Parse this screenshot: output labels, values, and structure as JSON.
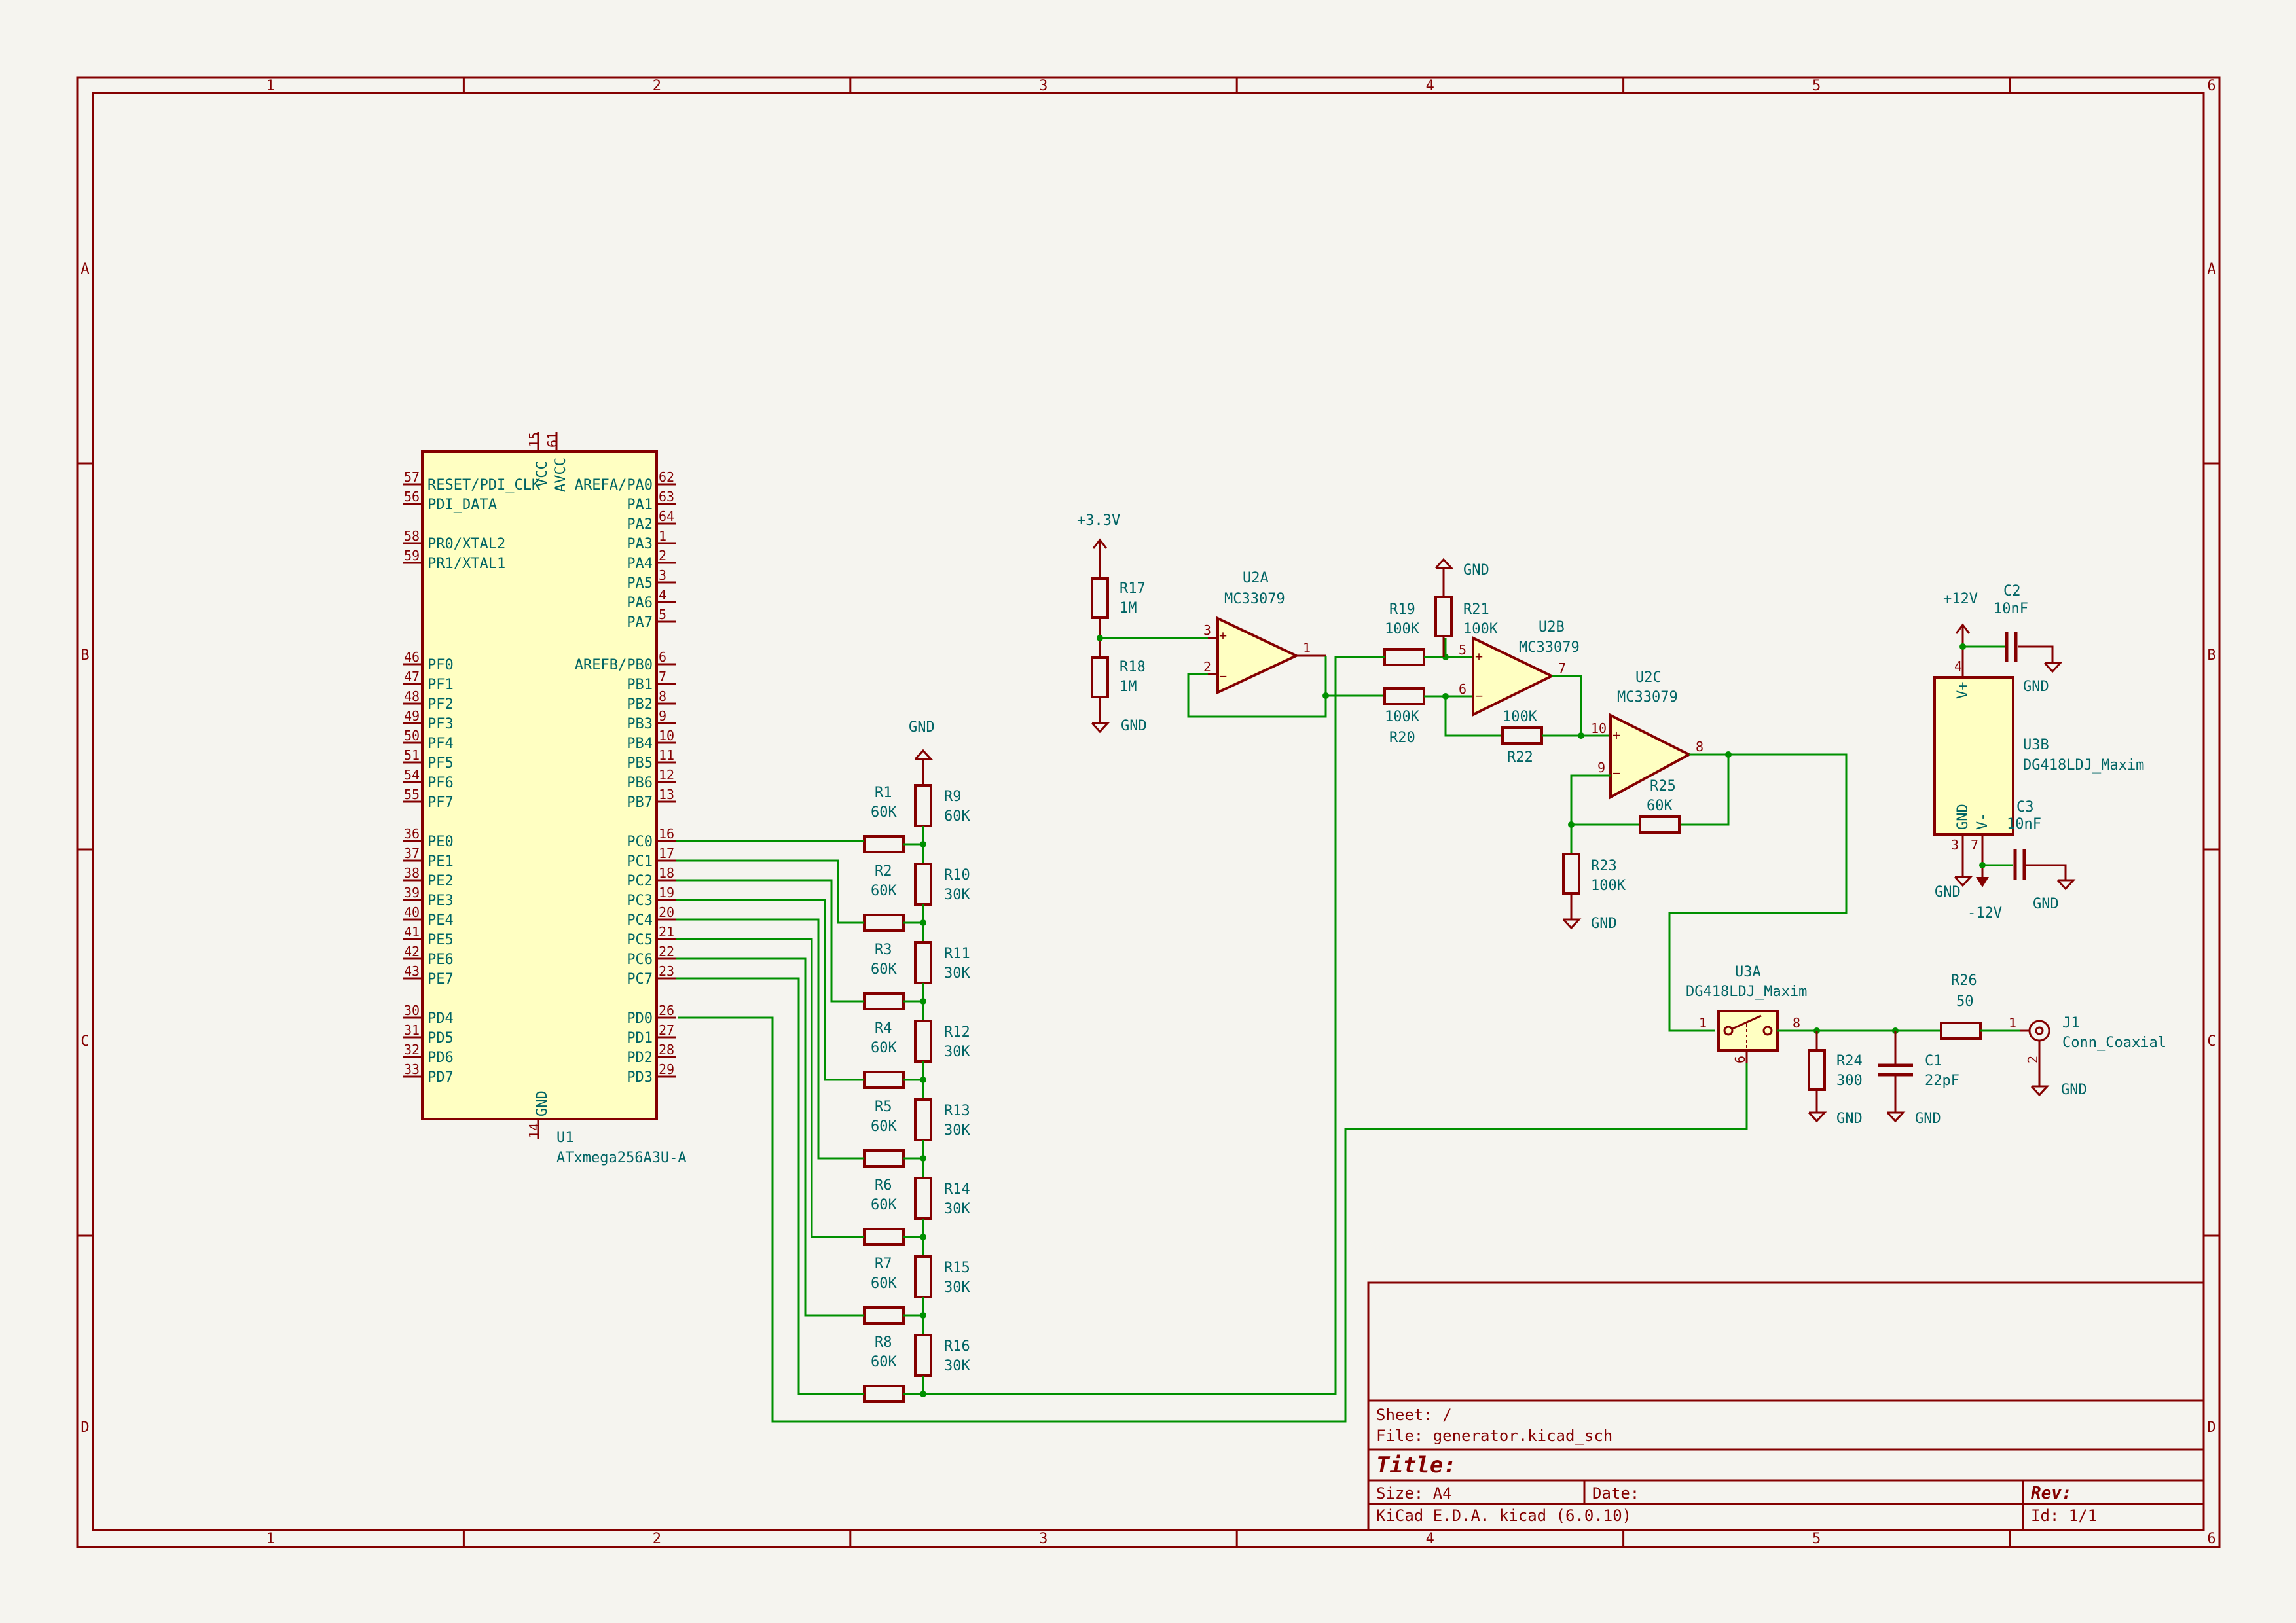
{
  "zones": {
    "columns": [
      "1",
      "2",
      "3",
      "4",
      "5",
      "6"
    ],
    "rows": [
      "A",
      "B",
      "C",
      "D"
    ]
  },
  "mcu": {
    "ref": "U1",
    "value": "ATxmega256A3U-A",
    "top_pins": [
      {
        "num": "15",
        "name": "VCC"
      },
      {
        "num": "61",
        "name": "AVCC"
      }
    ],
    "bottom_pin": {
      "num": "14",
      "name": "GND"
    },
    "left_pins": [
      {
        "num": "57",
        "name": "RESET/PDI_CLK"
      },
      {
        "num": "56",
        "name": "PDI_DATA"
      },
      {
        "num": "58",
        "name": "PR0/XTAL2"
      },
      {
        "num": "59",
        "name": "PR1/XTAL1"
      },
      {
        "num": "46",
        "name": "PF0"
      },
      {
        "num": "47",
        "name": "PF1"
      },
      {
        "num": "48",
        "name": "PF2"
      },
      {
        "num": "49",
        "name": "PF3"
      },
      {
        "num": "50",
        "name": "PF4"
      },
      {
        "num": "51",
        "name": "PF5"
      },
      {
        "num": "54",
        "name": "PF6"
      },
      {
        "num": "55",
        "name": "PF7"
      },
      {
        "num": "36",
        "name": "PE0"
      },
      {
        "num": "37",
        "name": "PE1"
      },
      {
        "num": "38",
        "name": "PE2"
      },
      {
        "num": "39",
        "name": "PE3"
      },
      {
        "num": "40",
        "name": "PE4"
      },
      {
        "num": "41",
        "name": "PE5"
      },
      {
        "num": "42",
        "name": "PE6"
      },
      {
        "num": "43",
        "name": "PE7"
      },
      {
        "num": "30",
        "name": "PD4"
      },
      {
        "num": "31",
        "name": "PD5"
      },
      {
        "num": "32",
        "name": "PD6"
      },
      {
        "num": "33",
        "name": "PD7"
      }
    ],
    "right_pins": [
      {
        "num": "62",
        "name": "AREFA/PA0"
      },
      {
        "num": "63",
        "name": "PA1"
      },
      {
        "num": "64",
        "name": "PA2"
      },
      {
        "num": "1",
        "name": "PA3"
      },
      {
        "num": "2",
        "name": "PA4"
      },
      {
        "num": "3",
        "name": "PA5"
      },
      {
        "num": "4",
        "name": "PA6"
      },
      {
        "num": "5",
        "name": "PA7"
      },
      {
        "num": "6",
        "name": "AREFB/PB0"
      },
      {
        "num": "7",
        "name": "PB1"
      },
      {
        "num": "8",
        "name": "PB2"
      },
      {
        "num": "9",
        "name": "PB3"
      },
      {
        "num": "10",
        "name": "PB4"
      },
      {
        "num": "11",
        "name": "PB5"
      },
      {
        "num": "12",
        "name": "PB6"
      },
      {
        "num": "13",
        "name": "PB7"
      },
      {
        "num": "16",
        "name": "PC0"
      },
      {
        "num": "17",
        "name": "PC1"
      },
      {
        "num": "18",
        "name": "PC2"
      },
      {
        "num": "19",
        "name": "PC3"
      },
      {
        "num": "20",
        "name": "PC4"
      },
      {
        "num": "21",
        "name": "PC5"
      },
      {
        "num": "22",
        "name": "PC6"
      },
      {
        "num": "23",
        "name": "PC7"
      },
      {
        "num": "26",
        "name": "PD0"
      },
      {
        "num": "27",
        "name": "PD1"
      },
      {
        "num": "28",
        "name": "PD2"
      },
      {
        "num": "29",
        "name": "PD3"
      }
    ]
  },
  "ladder": {
    "gnd": "GND",
    "series": [
      {
        "ref": "R1",
        "value": "60K"
      },
      {
        "ref": "R2",
        "value": "60K"
      },
      {
        "ref": "R3",
        "value": "60K"
      },
      {
        "ref": "R4",
        "value": "60K"
      },
      {
        "ref": "R5",
        "value": "60K"
      },
      {
        "ref": "R6",
        "value": "60K"
      },
      {
        "ref": "R7",
        "value": "60K"
      },
      {
        "ref": "R8",
        "value": "60K"
      }
    ],
    "shunt": [
      {
        "ref": "R9",
        "value": "60K"
      },
      {
        "ref": "R10",
        "value": "30K"
      },
      {
        "ref": "R11",
        "value": "30K"
      },
      {
        "ref": "R12",
        "value": "30K"
      },
      {
        "ref": "R13",
        "value": "30K"
      },
      {
        "ref": "R14",
        "value": "30K"
      },
      {
        "ref": "R15",
        "value": "30K"
      },
      {
        "ref": "R16",
        "value": "30K"
      }
    ]
  },
  "analog": {
    "v33": "+3.3V",
    "r17": {
      "ref": "R17",
      "value": "1M"
    },
    "r18": {
      "ref": "R18",
      "value": "1M"
    },
    "gnd": "GND",
    "u2a": {
      "ref": "U2A",
      "value": "MC33079",
      "p_in": "3",
      "n_in": "2",
      "out": "1"
    },
    "u2b": {
      "ref": "U2B",
      "value": "MC33079",
      "p_in": "5",
      "n_in": "6",
      "out": "7"
    },
    "u2c": {
      "ref": "U2C",
      "value": "MC33079",
      "p_in": "10",
      "n_in": "9",
      "out": "8"
    },
    "r19": {
      "ref": "R19",
      "value": "100K"
    },
    "r20": {
      "ref": "R20",
      "value": "100K"
    },
    "r21": {
      "ref": "R21",
      "value": "100K"
    },
    "r22": {
      "ref": "R22",
      "value": "100K"
    },
    "r23": {
      "ref": "R23",
      "value": "100K"
    },
    "r25": {
      "ref": "R25",
      "value": "60K"
    },
    "r24": {
      "ref": "R24",
      "value": "300"
    },
    "r26": {
      "ref": "R26",
      "value": "50"
    },
    "c1": {
      "ref": "C1",
      "value": "22pF"
    },
    "c2": {
      "ref": "C2",
      "value": "10nF"
    },
    "c3": {
      "ref": "C3",
      "value": "10nF"
    },
    "u3a": {
      "ref": "U3A",
      "value": "DG418LDJ_Maxim",
      "p1": "1",
      "p8": "8",
      "p6": "6"
    },
    "u3b": {
      "ref": "U3B",
      "value": "DG418LDJ_Maxim",
      "vp": "V+",
      "vm": "V-",
      "gnd": "GND",
      "p4": "4",
      "p3": "3",
      "p7": "7"
    },
    "v12p": "+12V",
    "v12n": "-12V",
    "j1": {
      "ref": "J1",
      "value": "Conn_Coaxial",
      "p1": "1",
      "p2": "2"
    }
  },
  "title_block": {
    "sheet": "Sheet: /",
    "file": "File: generator.kicad_sch",
    "title": "Title:",
    "size": "Size: A4",
    "date": "Date:",
    "rev": "Rev:",
    "tool": "KiCad E.D.A.  kicad (6.0.10)",
    "id": "Id: 1/1"
  }
}
